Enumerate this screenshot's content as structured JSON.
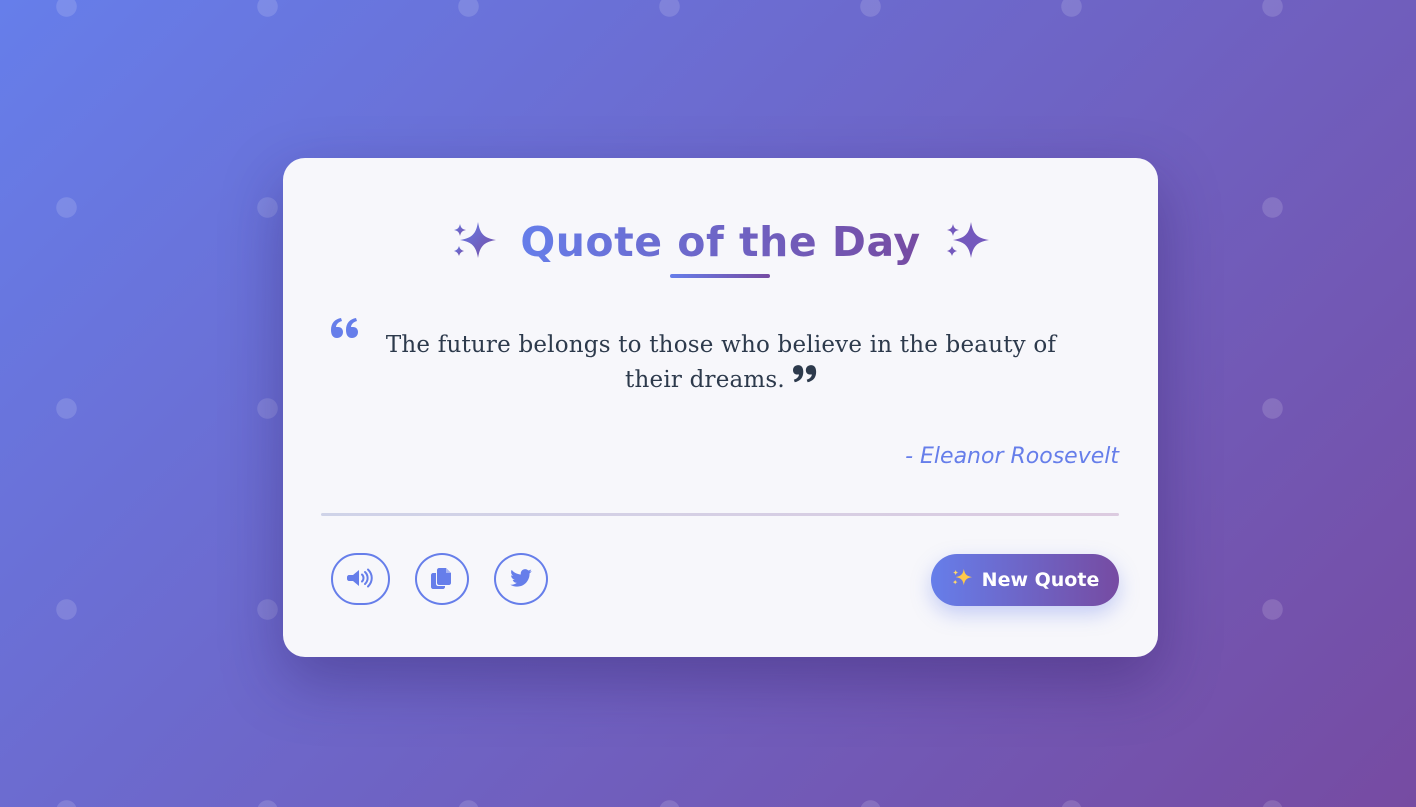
{
  "card": {
    "title": "Quote of the Day",
    "title_icon": "sparkles-icon"
  },
  "quote": {
    "text": "The future belongs to those who believe in the beauty of their dreams.",
    "author": "- Eleanor Roosevelt",
    "open_icon": "open-quote-icon",
    "close_icon": "close-quote-icon"
  },
  "actions": [
    {
      "name": "speak",
      "icon": "speaker-icon"
    },
    {
      "name": "copy",
      "icon": "copy-icon"
    },
    {
      "name": "tweet",
      "icon": "twitter-icon"
    }
  ],
  "new_quote_button": {
    "label": "New Quote",
    "icon": "sparkles-icon"
  },
  "colors": {
    "accent_start": "#667eea",
    "accent_end": "#764ba2",
    "card_background": "#f7f7fb",
    "text": "#2d3a4c"
  }
}
